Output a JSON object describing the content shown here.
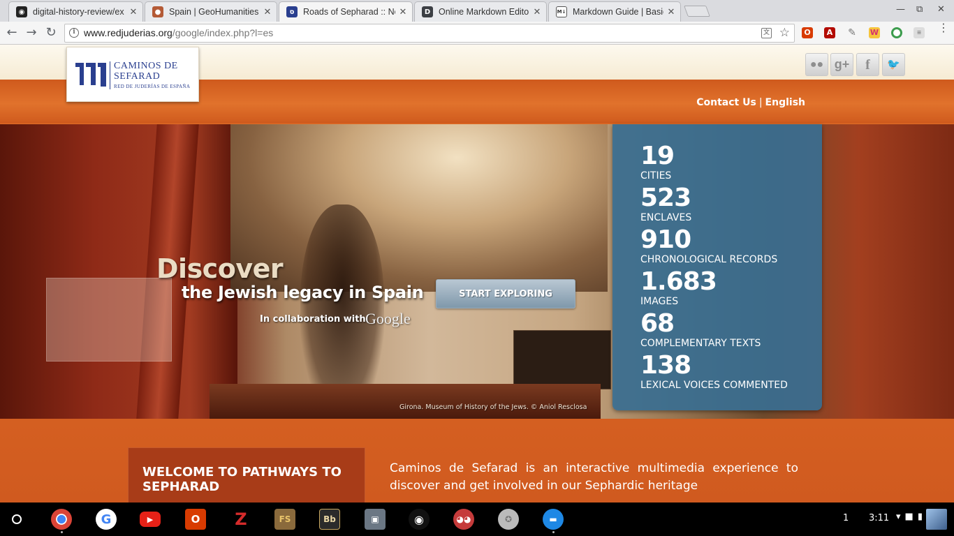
{
  "browser": {
    "tabs": [
      {
        "title": "digital-history-review/ex",
        "favicon": "github-icon",
        "active": false
      },
      {
        "title": "Spain | GeoHumanities",
        "favicon": "geohumanities-icon",
        "active": false
      },
      {
        "title": "Roads of Sepharad :: Ne",
        "favicon": "sepharad-icon",
        "active": true
      },
      {
        "title": "Online Markdown Editor",
        "favicon": "d-icon",
        "active": false
      },
      {
        "title": "Markdown Guide | Basic",
        "favicon": "markdown-icon",
        "active": false
      }
    ],
    "url_host": "www.redjuderias.org",
    "url_path": "/google/index.php?l=es",
    "extensions": [
      "office-icon",
      "acrobat-icon",
      "pen-icon",
      "wordflyer-icon",
      "chrome-remote-icon",
      "translate-ext-icon"
    ]
  },
  "site": {
    "logo": {
      "line1": "CAMINOS DE",
      "line2": "SEFARAD",
      "line3": "RED DE JUDERÍAS DE ESPAÑA"
    },
    "social": [
      "flickr-icon",
      "google-plus-icon",
      "facebook-icon",
      "twitter-icon"
    ],
    "nav": {
      "contact": "Contact Us",
      "separator": "|",
      "language": "English"
    },
    "hero": {
      "title": "Discover",
      "subtitle": "the Jewish legacy in Spain",
      "collab_text": "In collaboration with",
      "collab_brand": "Google",
      "cta": "START EXPLORING",
      "credit": "Girona. Museum of History of the Jews. © Aniol Resclosa"
    },
    "stats": [
      {
        "value": "19",
        "label": "CITIES"
      },
      {
        "value": "523",
        "label": "ENCLAVES"
      },
      {
        "value": "910",
        "label": "CHRONOLOGICAL RECORDS"
      },
      {
        "value": "1.683",
        "label": "IMAGES"
      },
      {
        "value": "68",
        "label": "COMPLEMENTARY TEXTS"
      },
      {
        "value": "138",
        "label": "LEXICAL VOICES COMMENTED"
      }
    ],
    "welcome_title": "WELCOME TO PATHWAYS TO SEPHARAD",
    "intro": "Caminos de Sefarad is an interactive multimedia experience to discover and get involved in our Sephardic heritage"
  },
  "shelf": {
    "apps": [
      "chrome-icon",
      "google-icon",
      "youtube-icon",
      "office-icon",
      "zotero-icon",
      "fs-icon",
      "blackboard-icon",
      "cube-icon",
      "github-icon",
      "owl-icon",
      "coin-icon",
      "files-icon"
    ],
    "notification_count": "1",
    "time": "3:11"
  },
  "colors": {
    "accent_orange": "#d9611f",
    "stats_blue": "#386e91",
    "button_blue": "#7f98ab"
  }
}
